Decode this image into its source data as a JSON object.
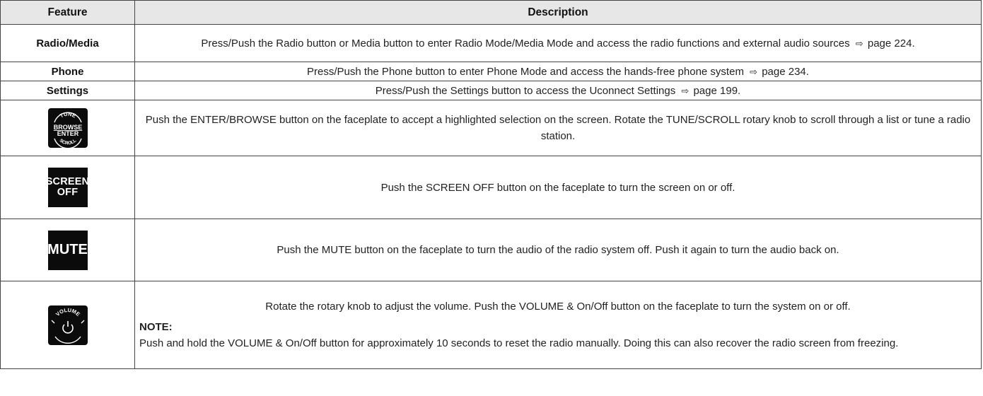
{
  "table": {
    "header": {
      "feature": "Feature",
      "description": "Description"
    },
    "rows": [
      {
        "feature": "Radio/Media",
        "desc_a": "Press/Push the Radio button or Media button to enter Radio Mode/Media Mode and access the radio functions and external audio sources",
        "desc_b": "page 224."
      },
      {
        "feature": "Phone",
        "desc_a": "Press/Push the Phone button to enter Phone Mode and access the hands-free phone system",
        "desc_b": "page 234."
      },
      {
        "feature": "Settings",
        "desc_a": "Press/Push the Settings button to access the Uconnect Settings",
        "desc_b": "page 199."
      },
      {
        "icon": "tune-browse-enter-knob-icon",
        "icon_text": {
          "tune": "TUNE",
          "browse": "BROWSE",
          "enter": "ENTER",
          "scroll": "SCROLL"
        },
        "desc": "Push the ENTER/BROWSE button on the faceplate to accept a highlighted selection on the screen. Rotate the TUNE/SCROLL rotary knob to scroll through a list or tune a radio station."
      },
      {
        "icon": "screen-off-button-icon",
        "icon_text": {
          "line1": "SCREEN",
          "line2": "OFF"
        },
        "desc": "Push the SCREEN OFF button on the faceplate to turn the screen on or off."
      },
      {
        "icon": "mute-button-icon",
        "icon_text": {
          "label": "MUTE"
        },
        "desc": "Push the MUTE button on the faceplate to turn the audio of the radio system off. Push it again to turn the audio back on."
      },
      {
        "icon": "volume-power-knob-icon",
        "icon_text": {
          "volume": "VOLUME"
        },
        "desc": "Rotate the rotary knob to adjust the volume. Push the VOLUME & On/Off button on the faceplate to turn the system on or off.",
        "note_label": "NOTE:",
        "note_text": "Push and hold the VOLUME & On/Off button for approximately 10 seconds to reset the radio manually. Doing this can also recover the radio screen from freezing."
      }
    ],
    "xref_glyph": "⇨"
  }
}
